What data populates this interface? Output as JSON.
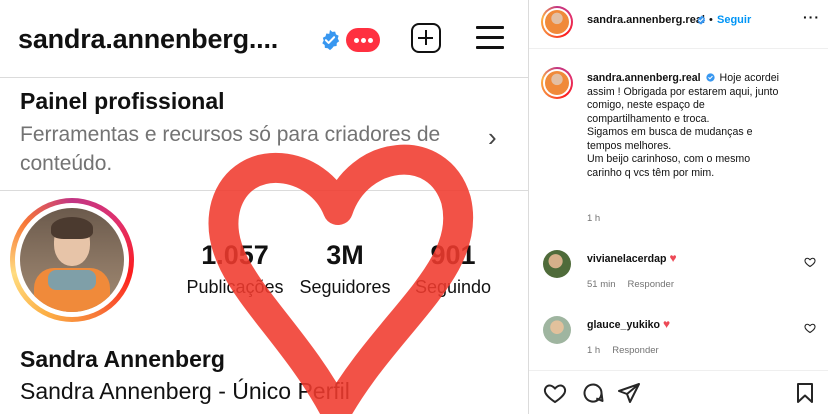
{
  "profile": {
    "username": "sandra.annenberg....",
    "panel_title": "Painel profissional",
    "panel_subtitle": "Ferramentas e recursos só para criadores de conteúdo.",
    "stats": [
      {
        "value": "1.057",
        "label": "Publicações"
      },
      {
        "value": "3M",
        "label": "Seguidores"
      },
      {
        "value": "901",
        "label": "Seguindo"
      }
    ],
    "name": "Sandra Annenberg",
    "bio": "Sandra Annenberg - Único Perfil"
  },
  "post": {
    "header_username": "sandra.annenberg.real",
    "separator": "•",
    "follow_label": "Seguir",
    "more_label": "···",
    "caption_username": "sandra.annenberg.real",
    "caption_lines": [
      "Hoje acordei",
      "assim ! Obrigada por estarem aqui, junto",
      "comigo, neste espaço de",
      "compartilhamento e troca.",
      "Sigamos em busca de mudanças e",
      "tempos melhores.",
      "Um beijo carinhoso, com o mesmo",
      "carinho q vcs têm por mim."
    ],
    "caption_time": "1 h",
    "comments": [
      {
        "user": "vivianelacerdap",
        "time": "51 min",
        "reply": "Responder"
      },
      {
        "user": "glauce_yukiko",
        "time": "1 h",
        "reply": "Responder"
      }
    ]
  },
  "colors": {
    "accent_blue": "#0095f6",
    "verified_blue": "#3897f0",
    "heart_red": "#ed4956",
    "overlay_heart": "#f03a2e"
  },
  "icons": [
    "verified-badge-icon",
    "notification-icon",
    "new-post-icon",
    "menu-icon",
    "chevron-right-icon",
    "more-icon",
    "heart-icon",
    "comment-icon",
    "share-icon",
    "bookmark-icon"
  ]
}
